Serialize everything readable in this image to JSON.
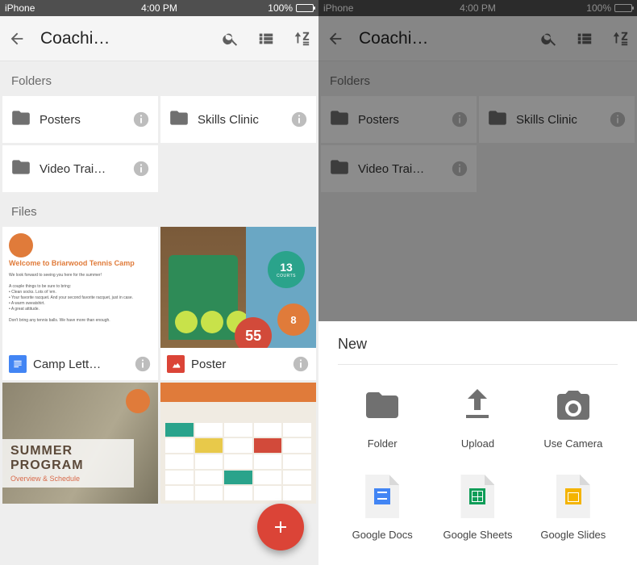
{
  "status": {
    "carrier": "iPhone",
    "time": "4:00 PM",
    "battery_pct": "100%"
  },
  "header": {
    "title": "Coachi…"
  },
  "sections": {
    "folders_label": "Folders",
    "files_label": "Files"
  },
  "folders": [
    {
      "name": "Posters"
    },
    {
      "name": "Skills Clinic"
    },
    {
      "name": "Video Trai…"
    }
  ],
  "files": [
    {
      "name": "Camp Lett…",
      "type": "docs"
    },
    {
      "name": "Poster",
      "type": "drawing"
    }
  ],
  "thumb1": {
    "title": "Welcome to Briarwood Tennis Camp"
  },
  "thumb2": {
    "badge1_num": "13",
    "badge1_sub": "COURTS",
    "badge2_num": "8",
    "badge3_num": "55"
  },
  "thumb3": {
    "line1a": "SUMMER",
    "line1b": "PROGRAM",
    "line2": "Overview & Schedule"
  },
  "sheet": {
    "title": "New",
    "items": [
      {
        "label": "Folder"
      },
      {
        "label": "Upload"
      },
      {
        "label": "Use Camera"
      },
      {
        "label": "Google Docs"
      },
      {
        "label": "Google Sheets"
      },
      {
        "label": "Google Slides"
      }
    ]
  }
}
